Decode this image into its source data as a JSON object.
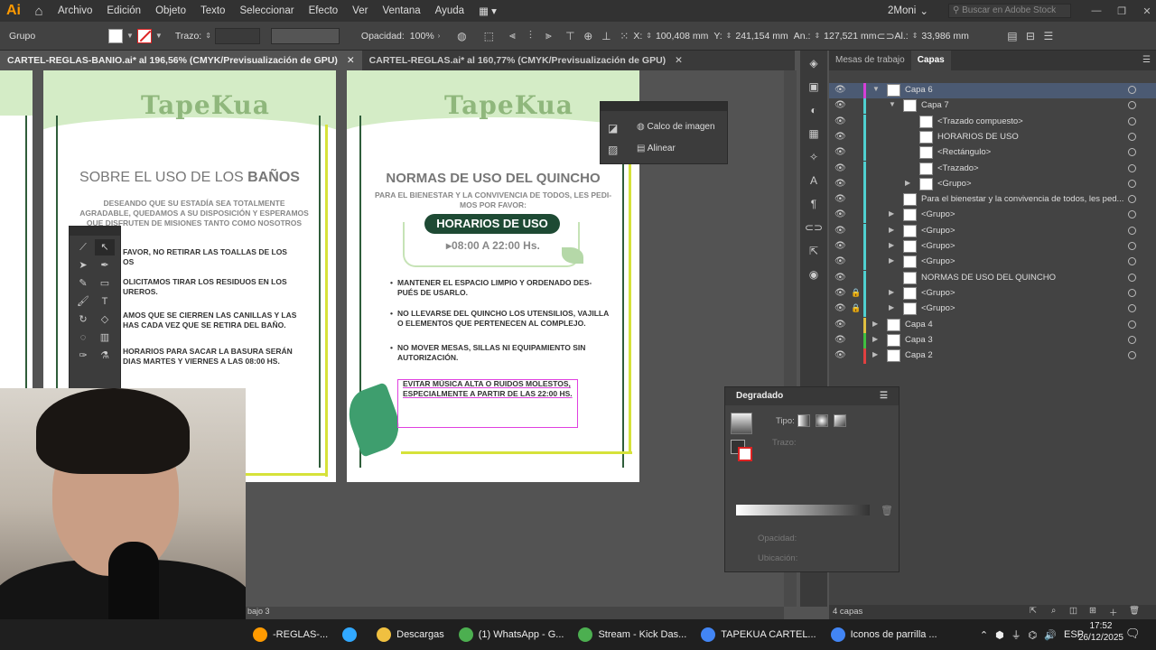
{
  "menubar": {
    "logo": "Ai",
    "items": [
      "Archivo",
      "Edición",
      "Objeto",
      "Texto",
      "Seleccionar",
      "Efecto",
      "Ver",
      "Ventana",
      "Ayuda"
    ],
    "workspace": "2Moni",
    "search_placeholder": "Buscar en Adobe Stock"
  },
  "control": {
    "selection_label": "Grupo",
    "stroke_label": "Trazo:",
    "opacity_label": "Opacidad:",
    "opacity_value": "100%",
    "x_label": "X:",
    "x_value": "100,408 mm",
    "y_label": "Y:",
    "y_value": "241,154 mm",
    "w_label": "An.:",
    "w_value": "127,521 mm",
    "h_label": "Al.:",
    "h_value": "33,986 mm"
  },
  "tabs": [
    {
      "label": "CARTEL-REGLAS-BANIO.ai* al 196,56% (CMYK/Previsualización de GPU)"
    },
    {
      "label": "CARTEL-REGLAS.ai* al 160,77% (CMYK/Previsualización de GPU)"
    }
  ],
  "artboard_left": {
    "logo": "TapeKua",
    "title_a": "SOBRE EL USO DE LOS ",
    "title_b": "BAÑOS",
    "subtitle": "DESEANDO QUE SU ESTADÍA SEA TOTALMENTE AGRADABLE, QUEDAMOS A SU DISPOSICIÓN Y ESPERAMOS QUE DISFRUTEN DE MISIONES TANTO COMO NOSOTROS",
    "bullets": [
      "FAVOR, NO RETIRAR LAS TOALLAS DE LOS\nOS",
      "OLICITAMOS TIRAR LOS RESIDUOS EN LOS\nUREROS.",
      "AMOS QUE SE CIERREN LAS CANILLAS Y LAS\nHAS CADA VEZ QUE SE RETIRA DEL BAÑO.",
      "HORARIOS PARA SACAR LA BASURA SERÁN\nDIAS MARTES Y VIERNES A LAS 08:00 HS."
    ]
  },
  "artboard_right": {
    "logo": "TapeKua",
    "title": "NORMAS DE USO DEL QUINCHO",
    "subtitle": "PARA EL BIENESTAR Y LA CONVIVENCIA DE TODOS, LES PEDI-\nMOS POR FAVOR:",
    "pill": "HORARIOS DE USO",
    "hours": "▸08:00 A 22:00 Hs.",
    "bullets": [
      "MANTENER EL ESPACIO LIMPIO Y ORDENADO DES-\nPUÉS DE USARLO.",
      "NO LLEVARSE DEL QUINCHO LOS UTENSILIOS, VAJILLA\nO ELEMENTOS QUE PERTENECEN AL COMPLEJO.",
      "NO MOVER MESAS, SILLAS NI EQUIPAMIENTO SIN\nAUTORIZACIÓN.",
      "EVITAR MÚSICA ALTA O RUIDOS MOLESTOS,\nESPECIALMENTE A PARTIR DE LAS 22:00 HS."
    ]
  },
  "image_trace_panel": {
    "items": [
      "Calco de imagen",
      "Alinear"
    ]
  },
  "layers_panel": {
    "tabs": [
      "Mesas de trabajo",
      "Capas"
    ],
    "rows": [
      {
        "name": "Capa 6",
        "indent": 0,
        "color": "#d63fd6",
        "expand": "open",
        "selected": true
      },
      {
        "name": "Capa 7",
        "indent": 1,
        "color": "#4fd0d0",
        "expand": "open"
      },
      {
        "name": "<Trazado compuesto>",
        "indent": 2,
        "color": "#4fd0d0",
        "expand": ""
      },
      {
        "name": "HORARIOS DE USO",
        "indent": 2,
        "color": "#4fd0d0",
        "expand": ""
      },
      {
        "name": "<Rectángulo>",
        "indent": 2,
        "color": "#4fd0d0",
        "expand": ""
      },
      {
        "name": "<Trazado>",
        "indent": 2,
        "color": "#4fd0d0",
        "expand": ""
      },
      {
        "name": "<Grupo>",
        "indent": 2,
        "color": "#4fd0d0",
        "expand": "closed"
      },
      {
        "name": "Para el bienestar y la convivencia de todos, les ped...",
        "indent": 1,
        "color": "#4fd0d0",
        "expand": ""
      },
      {
        "name": "<Grupo>",
        "indent": 1,
        "color": "#4fd0d0",
        "expand": "closed"
      },
      {
        "name": "<Grupo>",
        "indent": 1,
        "color": "#4fd0d0",
        "expand": "closed"
      },
      {
        "name": "<Grupo>",
        "indent": 1,
        "color": "#4fd0d0",
        "expand": "closed"
      },
      {
        "name": "<Grupo>",
        "indent": 1,
        "color": "#4fd0d0",
        "expand": "closed"
      },
      {
        "name": "NORMAS DE USO DEL QUINCHO",
        "indent": 1,
        "color": "#4fd0d0",
        "expand": ""
      },
      {
        "name": "<Grupo>",
        "indent": 1,
        "color": "#4fd0d0",
        "expand": "closed",
        "locked": true
      },
      {
        "name": "<Grupo>",
        "indent": 1,
        "color": "#4fd0d0",
        "expand": "closed",
        "locked": true
      },
      {
        "name": "Capa 4",
        "indent": 0,
        "color": "#e0c040",
        "expand": "closed"
      },
      {
        "name": "Capa 3",
        "indent": 0,
        "color": "#40c040",
        "expand": "closed"
      },
      {
        "name": "Capa 2",
        "indent": 0,
        "color": "#e04040",
        "expand": "closed"
      }
    ],
    "footer": "4 capas"
  },
  "gradient_panel": {
    "title": "Degradado",
    "type_label": "Tipo:",
    "stroke_label": "Trazo:",
    "opacity_label": "Opacidad:",
    "location_label": "Ubicación:"
  },
  "status": {
    "artboard": "bajo 3"
  },
  "taskbar": {
    "items": [
      {
        "label": "-REGLAS-...",
        "color": "#ff9a00"
      },
      {
        "label": "",
        "color": "#31a8ff"
      },
      {
        "label": "Descargas",
        "color": "#f0c040"
      },
      {
        "label": "(1) WhatsApp - G...",
        "color": "#4caf50"
      },
      {
        "label": "Stream - Kick Das...",
        "color": "#4caf50"
      },
      {
        "label": "TAPEKUA CARTEL...",
        "color": "#4285f4"
      },
      {
        "label": "Iconos de parrilla ...",
        "color": "#4285f4"
      }
    ],
    "lang": "ESP",
    "time": "17:52",
    "date": "26/12/2025"
  }
}
